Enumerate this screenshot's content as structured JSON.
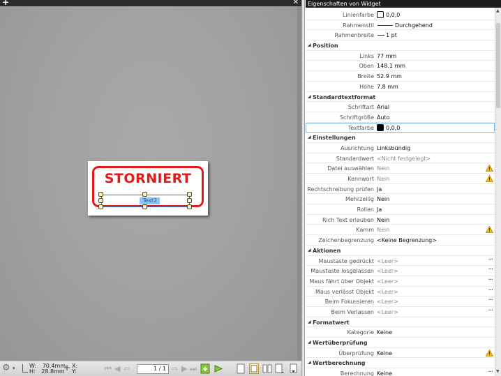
{
  "left": {
    "doc": {
      "stamp_text": "STORNIERT",
      "widget_label": "Text2"
    },
    "statusbar": {
      "width_label": "W:",
      "width_value": "70.4mm",
      "height_label": "H:",
      "height_value": "28.8mm",
      "x_label": "X:",
      "y_label": "Y:",
      "page_value": "1 / 1"
    }
  },
  "right": {
    "title": "Eigenschaften von Widget",
    "sections": [
      {
        "title": null,
        "rows": [
          {
            "label": "Linienfarbe",
            "value": "0,0,0",
            "kind": "swatch",
            "swatch": "white"
          },
          {
            "label": "Rahmenstil",
            "value": "Durchgehend",
            "kind": "line"
          },
          {
            "label": "Rahmenbreite",
            "value": "1 pt",
            "kind": "line-short"
          }
        ]
      },
      {
        "title": "Position",
        "rows": [
          {
            "label": "Links",
            "value": "77 mm"
          },
          {
            "label": "Oben",
            "value": "148.1 mm"
          },
          {
            "label": "Breite",
            "value": "52.9 mm"
          },
          {
            "label": "Höhe",
            "value": "7.8 mm"
          }
        ]
      },
      {
        "title": "Standardtextformat",
        "rows": [
          {
            "label": "Schriftart",
            "value": "Arial"
          },
          {
            "label": "Schriftgröße",
            "value": "Auto"
          },
          {
            "label": "Textfarbe",
            "value": "0,0,0",
            "kind": "swatch",
            "swatch": "black",
            "selected": true
          }
        ]
      },
      {
        "title": "Einstellungen",
        "rows": [
          {
            "label": "Ausrichtung",
            "value": "Linksbündig"
          },
          {
            "label": "Standardwert",
            "value": "<Nicht festgelegt>",
            "gray": true
          },
          {
            "label": "Datei auswählen",
            "value": "Nein",
            "gray": true,
            "warn": true
          },
          {
            "label": "Kennwort",
            "value": "Nein",
            "gray": true,
            "warn": true
          },
          {
            "label": "Rechtschreibung prüfen",
            "value": "Ja"
          },
          {
            "label": "Mehrzeilig",
            "value": "Nein"
          },
          {
            "label": "Rollen",
            "value": "Ja"
          },
          {
            "label": "Rich Text erlauben",
            "value": "Nein"
          },
          {
            "label": "Kamm",
            "value": "Nein",
            "gray": true,
            "warn": true
          },
          {
            "label": "Zeichenbegrenzung",
            "value": "<Keine Begrenzung>"
          }
        ]
      },
      {
        "title": "Aktionen",
        "rows": [
          {
            "label": "Maustaste gedrückt",
            "value": "<Leer>",
            "gray": true,
            "dots": true
          },
          {
            "label": "Maustaste losgelassen",
            "value": "<Leer>",
            "gray": true,
            "dots": true
          },
          {
            "label": "Maus fährt über Objekt",
            "value": "<Leer>",
            "gray": true,
            "dots": true
          },
          {
            "label": "Maus verlässt Objekt",
            "value": "<Leer>",
            "gray": true,
            "dots": true
          },
          {
            "label": "Beim Fokussieren",
            "value": "<Leer>",
            "gray": true,
            "dots": true
          },
          {
            "label": "Beim Verlassen",
            "value": "<Leer>",
            "gray": true,
            "dots": true
          }
        ]
      },
      {
        "title": "Formatwert",
        "rows": [
          {
            "label": "Kategorie",
            "value": "Keine"
          }
        ]
      },
      {
        "title": "Wertüberprüfung",
        "rows": [
          {
            "label": "Überprüfung",
            "value": "Keine",
            "warn": true
          }
        ]
      },
      {
        "title": "Wertberechnung",
        "rows": [
          {
            "label": "Berechnung",
            "value": "Keine",
            "dots": true
          }
        ]
      }
    ]
  },
  "colors": {
    "stamp_red": "#e21a1a",
    "selection_blue": "#2a6fd3",
    "warning_yellow": "#f3c11b"
  }
}
